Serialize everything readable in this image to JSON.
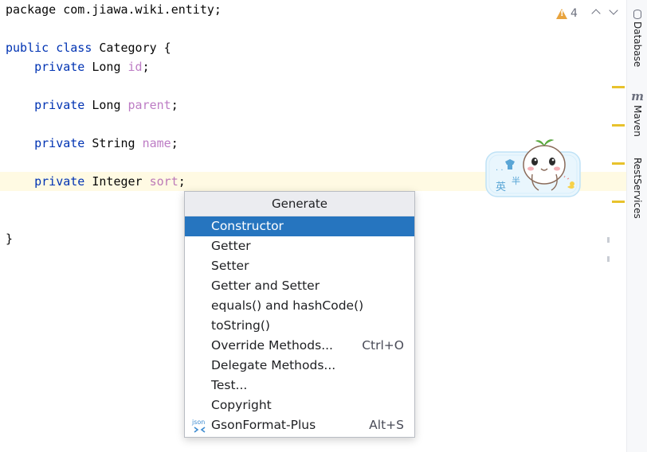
{
  "editor": {
    "lines": [
      {
        "parts": [
          {
            "t": "package ",
            "c": ""
          },
          {
            "t": "com.jiawa.wiki.entity;",
            "c": ""
          }
        ]
      },
      {
        "parts": []
      },
      {
        "parts": [
          {
            "t": "public class ",
            "c": "kw"
          },
          {
            "t": "Category {",
            "c": ""
          }
        ]
      },
      {
        "parts": [
          {
            "t": "    private ",
            "c": "kw"
          },
          {
            "t": "Long ",
            "c": ""
          },
          {
            "t": "id",
            "c": "field"
          },
          {
            "t": ";",
            "c": ""
          }
        ]
      },
      {
        "parts": []
      },
      {
        "parts": [
          {
            "t": "    private ",
            "c": "kw"
          },
          {
            "t": "Long ",
            "c": ""
          },
          {
            "t": "parent",
            "c": "field"
          },
          {
            "t": ";",
            "c": ""
          }
        ]
      },
      {
        "parts": []
      },
      {
        "parts": [
          {
            "t": "    private ",
            "c": "kw"
          },
          {
            "t": "String ",
            "c": ""
          },
          {
            "t": "name",
            "c": "field"
          },
          {
            "t": ";",
            "c": ""
          }
        ]
      },
      {
        "parts": []
      },
      {
        "parts": [
          {
            "t": "    private ",
            "c": "kw"
          },
          {
            "t": "Integer ",
            "c": ""
          },
          {
            "t": "sort",
            "c": "field"
          },
          {
            "t": ";",
            "c": ""
          }
        ]
      },
      {
        "parts": []
      },
      {
        "parts": []
      },
      {
        "parts": [
          {
            "t": "}",
            "c": ""
          }
        ]
      }
    ]
  },
  "inspection": {
    "warning_count": "4",
    "icon": "warning-triangle-icon"
  },
  "right_panel": {
    "tabs": [
      {
        "label": "Database",
        "icon": "database-icon"
      },
      {
        "label": "Maven",
        "icon": "maven-icon"
      },
      {
        "label": "RestServices",
        "icon": ""
      }
    ]
  },
  "mascot": {
    "text1": "英",
    "text2": "半",
    "text3": "·",
    "text4": "· ·"
  },
  "popup": {
    "title": "Generate",
    "items": [
      {
        "label": "Constructor",
        "shortcut": "",
        "selected": true
      },
      {
        "label": "Getter",
        "shortcut": ""
      },
      {
        "label": "Setter",
        "shortcut": ""
      },
      {
        "label": "Getter and Setter",
        "shortcut": ""
      },
      {
        "label": "equals() and hashCode()",
        "shortcut": ""
      },
      {
        "label": "toString()",
        "shortcut": ""
      },
      {
        "label": "Override Methods...",
        "shortcut": "Ctrl+O"
      },
      {
        "label": "Delegate Methods...",
        "shortcut": ""
      },
      {
        "label": "Test...",
        "shortcut": ""
      },
      {
        "label": "Copyright",
        "shortcut": ""
      },
      {
        "label": "GsonFormat-Plus",
        "shortcut": "Alt+S",
        "icon_text": "json"
      }
    ]
  },
  "colors": {
    "accent": "#2675bf",
    "keyword": "#0033b3",
    "field": "#871094",
    "warning": "#e8a33d",
    "marker": "#e8c22c"
  }
}
